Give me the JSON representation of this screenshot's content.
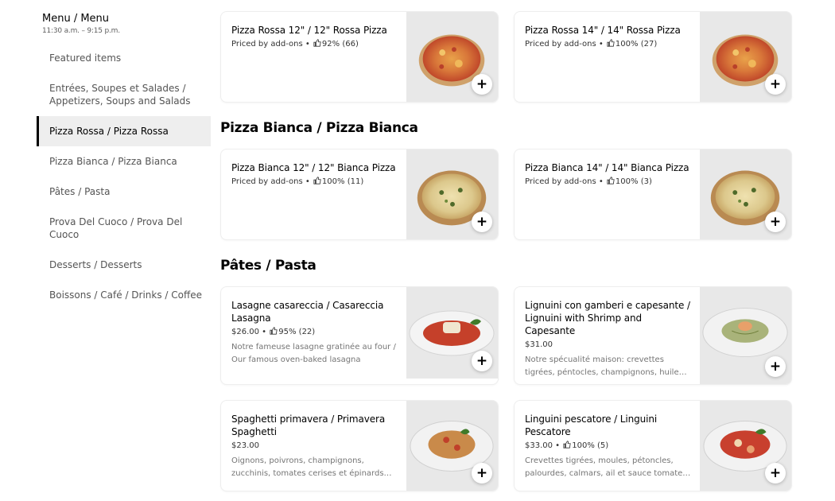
{
  "menu": {
    "title": "Menu / Menu",
    "hours": "11:30 a.m. – 9:15 p.m."
  },
  "sidebar": {
    "items": [
      {
        "label": "Featured items"
      },
      {
        "label": "Entrées, Soupes et Salades / Appetizers, Soups and Salads"
      },
      {
        "label": "Pizza Rossa / Pizza Rossa",
        "active": true
      },
      {
        "label": "Pizza Bianca / Pizza Bianca"
      },
      {
        "label": "Pâtes / Pasta"
      },
      {
        "label": "Prova Del Cuoco / Prova Del Cuoco"
      },
      {
        "label": "Desserts / Desserts"
      },
      {
        "label": "Boissons / Café / Drinks / Coffee"
      }
    ]
  },
  "sections": {
    "bianca": {
      "title": "Pizza Bianca / Pizza Bianca"
    },
    "pasta": {
      "title": "Pâtes / Pasta"
    }
  },
  "items": {
    "rossa12": {
      "name": "Pizza Rossa 12\" / 12\" Rossa Pizza",
      "price": "Priced by add-ons",
      "rating": "92% (66)",
      "image_icon": "pizza-rossa-image"
    },
    "rossa14": {
      "name": "Pizza Rossa 14\" / 14\" Rossa Pizza",
      "price": "Priced by add-ons",
      "rating": "100% (27)",
      "image_icon": "pizza-rossa-image"
    },
    "bianca12": {
      "name": "Pizza Bianca 12\" / 12\" Bianca Pizza",
      "price": "Priced by add-ons",
      "rating": "100% (11)",
      "image_icon": "pizza-bianca-image"
    },
    "bianca14": {
      "name": "Pizza Bianca 14\" / 14\" Bianca Pizza",
      "price": "Priced by add-ons",
      "rating": "100% (3)",
      "image_icon": "pizza-bianca-image"
    },
    "lasagne": {
      "name": "Lasagne casareccia / Casareccia Lasagna",
      "price": "$26.00",
      "rating": "95% (22)",
      "description": "Notre fameuse lasagne gratinée au four / Our famous oven-baked lasagna",
      "image_icon": "lasagna-image"
    },
    "linguini_shrimp": {
      "name": "Lignuini con gamberi e capesante / Lignuini with Shrimp and Capesante",
      "price": "$31.00",
      "description": "Notre spécualité maison: crevettes tigrées, péntocles, champignons, huile…",
      "image_icon": "linguini-shrimp-image"
    },
    "primavera": {
      "name": "Spaghetti primavera / Primavera Spaghetti",
      "price": "$23.00",
      "description": "Oignons, poivrons, champignons, zucchinis, tomates cerises et épinards…",
      "image_icon": "spaghetti-image"
    },
    "pescatore": {
      "name": "Linguini pescatore / Linguini Pescatore",
      "price": "$33.00",
      "rating": "100% (5)",
      "description": "Crevettes tigrées, moules, pétoncles, palourdes, calmars, ail et sauce tomate…",
      "image_icon": "pescatore-image"
    }
  },
  "separator": " • ",
  "add_label": "+",
  "colors": {
    "accent": "#000000",
    "active_bg": "#eeeeee",
    "image_bg": "#e8e8e8",
    "muted_text": "#757575"
  }
}
